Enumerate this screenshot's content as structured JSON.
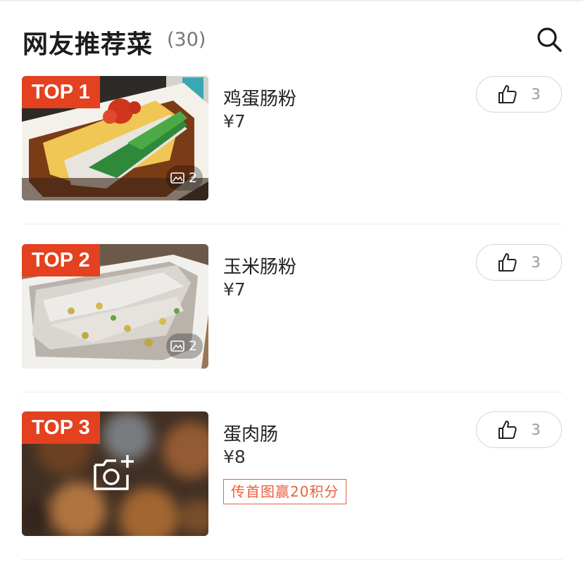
{
  "header": {
    "title": "网友推荐菜",
    "count": "(30)",
    "search_icon": "search-icon"
  },
  "dishes": [
    {
      "rank": "TOP 1",
      "name": "鸡蛋肠粉",
      "price": "¥7",
      "image_count": "2",
      "likes": "3"
    },
    {
      "rank": "TOP 2",
      "name": "玉米肠粉",
      "price": "¥7",
      "image_count": "2",
      "likes": "3"
    },
    {
      "rank": "TOP 3",
      "name": "蛋肉肠",
      "price": "¥8",
      "promo": "传首图赢20积分",
      "likes": "3"
    }
  ],
  "colors": {
    "badge": "#e3411f",
    "promo": "#e9603d",
    "title": "#1c1c1c",
    "muted": "#999999"
  },
  "icons": [
    "search-icon",
    "image-icon",
    "thumbs-up-icon",
    "add-photo-icon"
  ]
}
